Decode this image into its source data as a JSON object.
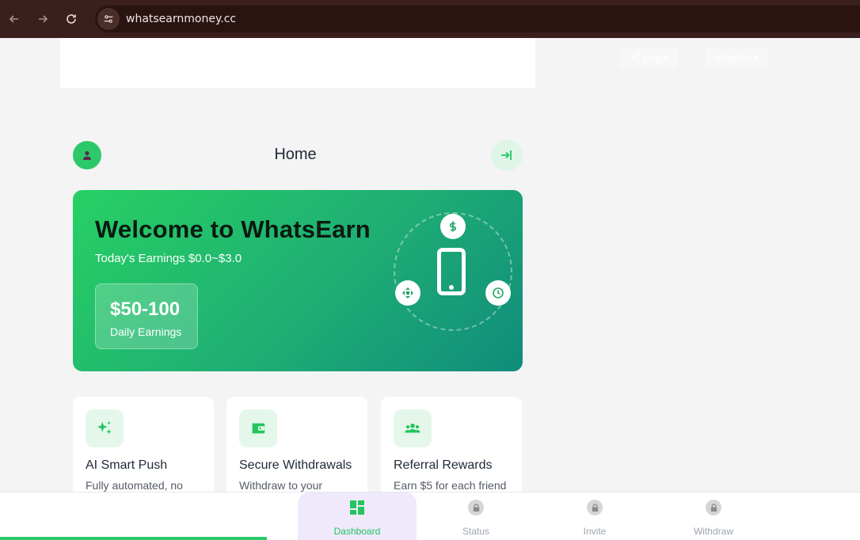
{
  "browser": {
    "url": "whatsearnmoney.cc"
  },
  "header": {
    "login_label": "Login",
    "language_label": "English ▾"
  },
  "page": {
    "title": "Home"
  },
  "hero": {
    "title": "Welcome to WhatsEarn",
    "subtitle": "Today's Earnings $0.0~$3.0",
    "earn_amount": "$50-100",
    "earn_label": "Daily Earnings"
  },
  "features": [
    {
      "title": "AI Smart Push",
      "desc": "Fully automated, no",
      "icon": "sparkles-icon"
    },
    {
      "title": "Secure Withdrawals",
      "desc": "Withdraw to your",
      "icon": "wallet-icon"
    },
    {
      "title": "Referral Rewards",
      "desc": "Earn $5 for each friend",
      "icon": "users-icon"
    }
  ],
  "bottom_nav": {
    "progress": 0.31,
    "tabs": [
      {
        "label": "Dashboard",
        "icon": "dashboard-icon",
        "active": true
      },
      {
        "label": "Status",
        "icon": "lock-icon",
        "active": false
      },
      {
        "label": "Invite",
        "icon": "lock-icon",
        "active": false
      },
      {
        "label": "Withdraw",
        "icon": "lock-icon",
        "active": false
      }
    ]
  },
  "colors": {
    "brand_green": "#22c55e",
    "browser_bar": "#3b1f1c",
    "active_tab_bg": "#efe9fb"
  }
}
